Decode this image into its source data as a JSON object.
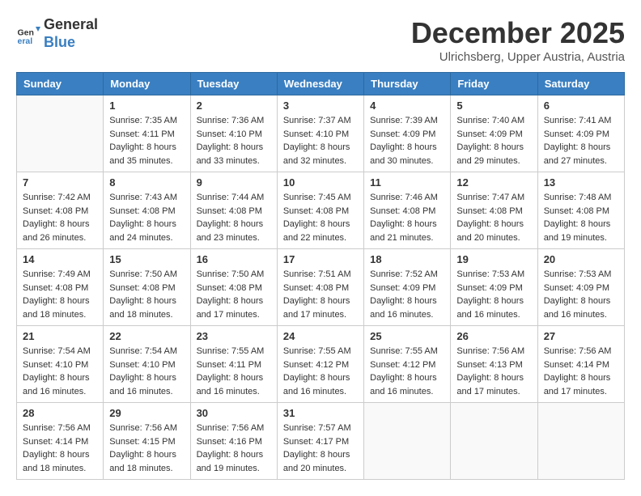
{
  "header": {
    "logo_general": "General",
    "logo_blue": "Blue",
    "month_title": "December 2025",
    "location": "Ulrichsberg, Upper Austria, Austria"
  },
  "days_of_week": [
    "Sunday",
    "Monday",
    "Tuesday",
    "Wednesday",
    "Thursday",
    "Friday",
    "Saturday"
  ],
  "weeks": [
    [
      {
        "day": "",
        "empty": true
      },
      {
        "day": "1",
        "sunrise": "7:35 AM",
        "sunset": "4:11 PM",
        "daylight": "8 hours and 35 minutes."
      },
      {
        "day": "2",
        "sunrise": "7:36 AM",
        "sunset": "4:10 PM",
        "daylight": "8 hours and 33 minutes."
      },
      {
        "day": "3",
        "sunrise": "7:37 AM",
        "sunset": "4:10 PM",
        "daylight": "8 hours and 32 minutes."
      },
      {
        "day": "4",
        "sunrise": "7:39 AM",
        "sunset": "4:09 PM",
        "daylight": "8 hours and 30 minutes."
      },
      {
        "day": "5",
        "sunrise": "7:40 AM",
        "sunset": "4:09 PM",
        "daylight": "8 hours and 29 minutes."
      },
      {
        "day": "6",
        "sunrise": "7:41 AM",
        "sunset": "4:09 PM",
        "daylight": "8 hours and 27 minutes."
      }
    ],
    [
      {
        "day": "7",
        "sunrise": "7:42 AM",
        "sunset": "4:08 PM",
        "daylight": "8 hours and 26 minutes."
      },
      {
        "day": "8",
        "sunrise": "7:43 AM",
        "sunset": "4:08 PM",
        "daylight": "8 hours and 24 minutes."
      },
      {
        "day": "9",
        "sunrise": "7:44 AM",
        "sunset": "4:08 PM",
        "daylight": "8 hours and 23 minutes."
      },
      {
        "day": "10",
        "sunrise": "7:45 AM",
        "sunset": "4:08 PM",
        "daylight": "8 hours and 22 minutes."
      },
      {
        "day": "11",
        "sunrise": "7:46 AM",
        "sunset": "4:08 PM",
        "daylight": "8 hours and 21 minutes."
      },
      {
        "day": "12",
        "sunrise": "7:47 AM",
        "sunset": "4:08 PM",
        "daylight": "8 hours and 20 minutes."
      },
      {
        "day": "13",
        "sunrise": "7:48 AM",
        "sunset": "4:08 PM",
        "daylight": "8 hours and 19 minutes."
      }
    ],
    [
      {
        "day": "14",
        "sunrise": "7:49 AM",
        "sunset": "4:08 PM",
        "daylight": "8 hours and 18 minutes."
      },
      {
        "day": "15",
        "sunrise": "7:50 AM",
        "sunset": "4:08 PM",
        "daylight": "8 hours and 18 minutes."
      },
      {
        "day": "16",
        "sunrise": "7:50 AM",
        "sunset": "4:08 PM",
        "daylight": "8 hours and 17 minutes."
      },
      {
        "day": "17",
        "sunrise": "7:51 AM",
        "sunset": "4:08 PM",
        "daylight": "8 hours and 17 minutes."
      },
      {
        "day": "18",
        "sunrise": "7:52 AM",
        "sunset": "4:09 PM",
        "daylight": "8 hours and 16 minutes."
      },
      {
        "day": "19",
        "sunrise": "7:53 AM",
        "sunset": "4:09 PM",
        "daylight": "8 hours and 16 minutes."
      },
      {
        "day": "20",
        "sunrise": "7:53 AM",
        "sunset": "4:09 PM",
        "daylight": "8 hours and 16 minutes."
      }
    ],
    [
      {
        "day": "21",
        "sunrise": "7:54 AM",
        "sunset": "4:10 PM",
        "daylight": "8 hours and 16 minutes."
      },
      {
        "day": "22",
        "sunrise": "7:54 AM",
        "sunset": "4:10 PM",
        "daylight": "8 hours and 16 minutes."
      },
      {
        "day": "23",
        "sunrise": "7:55 AM",
        "sunset": "4:11 PM",
        "daylight": "8 hours and 16 minutes."
      },
      {
        "day": "24",
        "sunrise": "7:55 AM",
        "sunset": "4:12 PM",
        "daylight": "8 hours and 16 minutes."
      },
      {
        "day": "25",
        "sunrise": "7:55 AM",
        "sunset": "4:12 PM",
        "daylight": "8 hours and 16 minutes."
      },
      {
        "day": "26",
        "sunrise": "7:56 AM",
        "sunset": "4:13 PM",
        "daylight": "8 hours and 17 minutes."
      },
      {
        "day": "27",
        "sunrise": "7:56 AM",
        "sunset": "4:14 PM",
        "daylight": "8 hours and 17 minutes."
      }
    ],
    [
      {
        "day": "28",
        "sunrise": "7:56 AM",
        "sunset": "4:14 PM",
        "daylight": "8 hours and 18 minutes."
      },
      {
        "day": "29",
        "sunrise": "7:56 AM",
        "sunset": "4:15 PM",
        "daylight": "8 hours and 18 minutes."
      },
      {
        "day": "30",
        "sunrise": "7:56 AM",
        "sunset": "4:16 PM",
        "daylight": "8 hours and 19 minutes."
      },
      {
        "day": "31",
        "sunrise": "7:57 AM",
        "sunset": "4:17 PM",
        "daylight": "8 hours and 20 minutes."
      },
      {
        "day": "",
        "empty": true
      },
      {
        "day": "",
        "empty": true
      },
      {
        "day": "",
        "empty": true
      }
    ]
  ]
}
